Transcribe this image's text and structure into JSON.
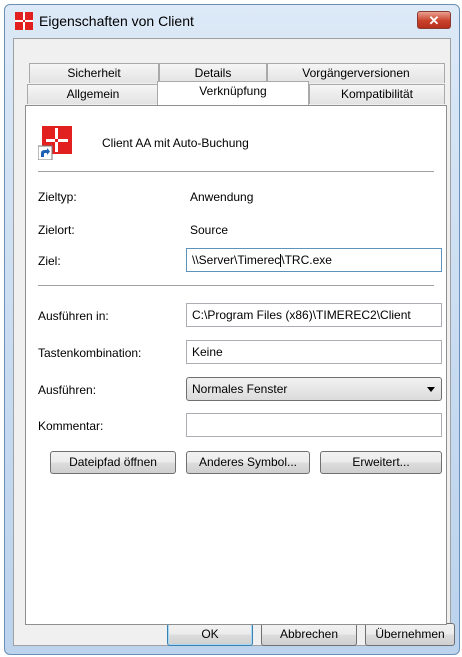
{
  "window": {
    "title": "Eigenschaften von Client",
    "close_symbol": "✕"
  },
  "tabs": {
    "row_back": [
      "Sicherheit",
      "Details",
      "Vorgängerversionen"
    ],
    "row_front": [
      "Allgemein",
      "Verknüpfung",
      "Kompatibilität"
    ],
    "active": "Verknüpfung"
  },
  "shortcut": {
    "name": "Client AA mit Auto-Buchung",
    "icon": "shortcut-app-icon"
  },
  "fields": {
    "zieltyp_label": "Zieltyp:",
    "zieltyp_value": "Anwendung",
    "zielort_label": "Zielort:",
    "zielort_value": "Source",
    "ziel_label": "Ziel:",
    "ziel_value_before_caret": "\\\\Server\\Timerec",
    "ziel_value_after_caret": "\\TRC.exe",
    "ausfuehren_in_label": "Ausführen in:",
    "ausfuehren_in_value": "C:\\Program Files (x86)\\TIMEREC2\\Client",
    "tastenkombination_label": "Tastenkombination:",
    "tastenkombination_value": "Keine",
    "ausfuehren_label": "Ausführen:",
    "ausfuehren_value": "Normales Fenster",
    "kommentar_label": "Kommentar:",
    "kommentar_value": ""
  },
  "buttons": {
    "dateipfad": "Dateipfad öffnen",
    "anderes_symbol": "Anderes Symbol...",
    "erweitert": "Erweitert...",
    "ok": "OK",
    "abbrechen": "Abbrechen",
    "uebernehmen": "Übernehmen"
  },
  "colors": {
    "titlebar": "#c6daf0",
    "close_button": "#c9412b",
    "panel": "#ffffff",
    "dialog_face": "#f0f0f0"
  }
}
